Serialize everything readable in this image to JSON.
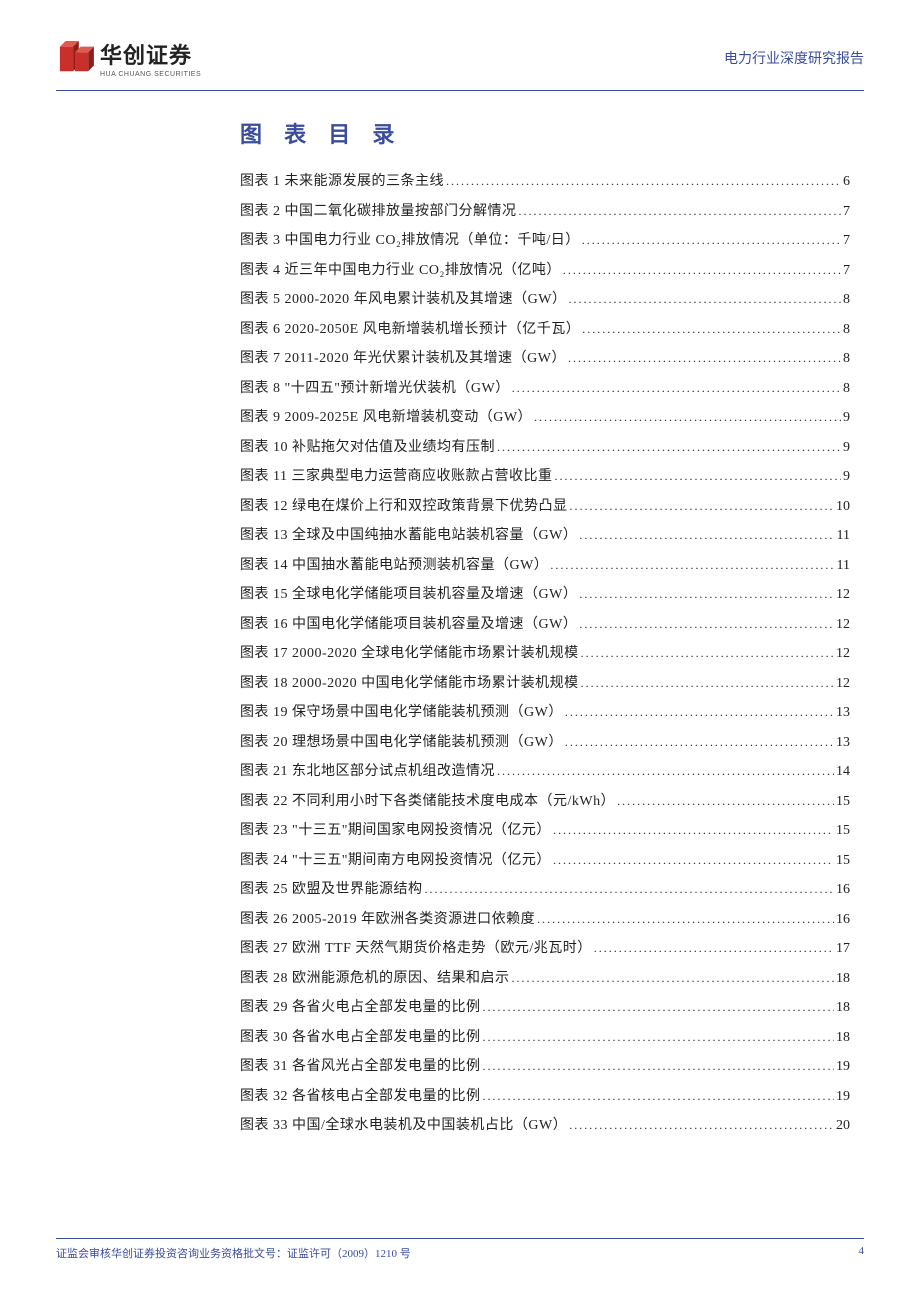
{
  "header": {
    "logo_cn": "华创证券",
    "logo_en": "HUA CHUANG SECURITIES",
    "right_text": "电力行业深度研究报告"
  },
  "toc": {
    "title": "图 表 目 录",
    "items": [
      {
        "label": "图表 1  未来能源发展的三条主线",
        "page": "6"
      },
      {
        "label": "图表 2  中国二氧化碳排放量按部门分解情况",
        "page": "7"
      },
      {
        "label": "图表 3  中国电力行业 CO₂排放情况（单位：千吨/日）",
        "page": "7"
      },
      {
        "label": "图表 4  近三年中国电力行业 CO₂排放情况（亿吨）",
        "page": "7"
      },
      {
        "label": "图表 5  2000-2020 年风电累计装机及其增速（GW）",
        "page": "8"
      },
      {
        "label": "图表 6  2020-2050E 风电新增装机增长预计（亿千瓦）",
        "page": "8"
      },
      {
        "label": "图表 7  2011-2020 年光伏累计装机及其增速（GW）",
        "page": "8"
      },
      {
        "label": "图表 8  \"十四五\"预计新增光伏装机（GW）",
        "page": "8"
      },
      {
        "label": "图表 9  2009-2025E 风电新增装机变动（GW）",
        "page": "9"
      },
      {
        "label": "图表 10  补贴拖欠对估值及业绩均有压制",
        "page": "9"
      },
      {
        "label": "图表 11  三家典型电力运营商应收账款占营收比重",
        "page": "9"
      },
      {
        "label": "图表 12  绿电在煤价上行和双控政策背景下优势凸显",
        "page": "10"
      },
      {
        "label": "图表 13  全球及中国纯抽水蓄能电站装机容量（GW）",
        "page": "11"
      },
      {
        "label": "图表 14  中国抽水蓄能电站预测装机容量（GW）",
        "page": "11"
      },
      {
        "label": "图表 15  全球电化学储能项目装机容量及增速（GW）",
        "page": "12"
      },
      {
        "label": "图表 16  中国电化学储能项目装机容量及增速（GW）",
        "page": "12"
      },
      {
        "label": "图表 17  2000-2020 全球电化学储能市场累计装机规模",
        "page": "12"
      },
      {
        "label": "图表 18  2000-2020 中国电化学储能市场累计装机规模",
        "page": "12"
      },
      {
        "label": "图表 19  保守场景中国电化学储能装机预测（GW）",
        "page": "13"
      },
      {
        "label": "图表 20  理想场景中国电化学储能装机预测（GW）",
        "page": "13"
      },
      {
        "label": "图表 21  东北地区部分试点机组改造情况",
        "page": "14"
      },
      {
        "label": "图表 22  不同利用小时下各类储能技术度电成本（元/kWh）",
        "page": "15"
      },
      {
        "label": "图表 23  \"十三五\"期间国家电网投资情况（亿元）",
        "page": "15"
      },
      {
        "label": "图表 24  \"十三五\"期间南方电网投资情况（亿元）",
        "page": "15"
      },
      {
        "label": "图表 25  欧盟及世界能源结构",
        "page": "16"
      },
      {
        "label": "图表 26  2005-2019 年欧洲各类资源进口依赖度",
        "page": "16"
      },
      {
        "label": "图表 27  欧洲 TTF 天然气期货价格走势（欧元/兆瓦时）",
        "page": "17"
      },
      {
        "label": "图表 28  欧洲能源危机的原因、结果和启示",
        "page": "18"
      },
      {
        "label": "图表 29  各省火电占全部发电量的比例",
        "page": "18"
      },
      {
        "label": "图表 30  各省水电占全部发电量的比例",
        "page": "18"
      },
      {
        "label": "图表 31  各省风光占全部发电量的比例",
        "page": "19"
      },
      {
        "label": "图表 32  各省核电占全部发电量的比例",
        "page": "19"
      },
      {
        "label": "图表 33  中国/全球水电装机及中国装机占比（GW）",
        "page": "20"
      }
    ]
  },
  "footer": {
    "left": "证监会审核华创证券投资咨询业务资格批文号：证监许可（2009）1210 号",
    "right": "4"
  }
}
